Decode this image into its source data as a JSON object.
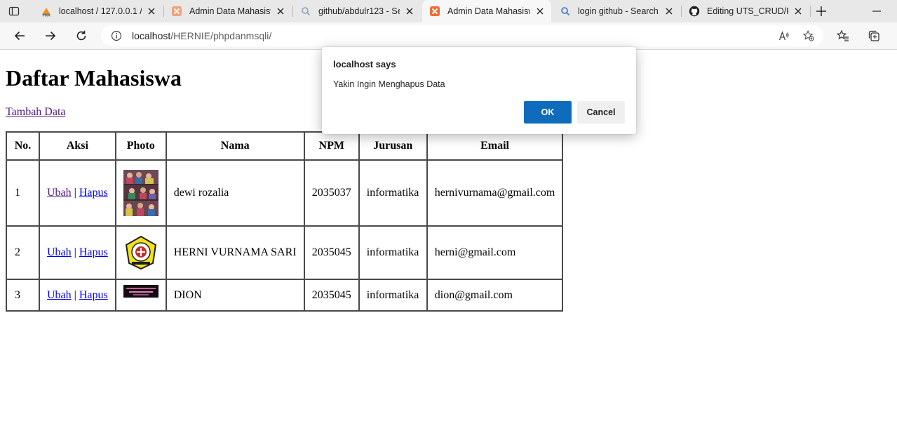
{
  "browser": {
    "tabs": [
      {
        "title": "localhost / 127.0.0.1 / t",
        "icon": "phpmyadmin-icon",
        "active": false
      },
      {
        "title": "Admin Data Mahasisw",
        "icon": "xampp-icon",
        "active": false
      },
      {
        "title": "github/abdulr123 - Se",
        "icon": "search-icon",
        "active": false
      },
      {
        "title": "Admin Data Mahasisw",
        "icon": "xampp-icon",
        "active": true
      },
      {
        "title": "login github - Search",
        "icon": "search-icon",
        "active": false
      },
      {
        "title": "Editing UTS_CRUD/RE",
        "icon": "github-icon",
        "active": false
      }
    ],
    "address": {
      "host": "localhost",
      "path": "/HERNIE/phpdanmsqli/"
    }
  },
  "page": {
    "heading": "Daftar Mahasiswa",
    "add_link": "Tambah Data",
    "table": {
      "headers": [
        "No.",
        "Aksi",
        "Photo",
        "Nama",
        "NPM",
        "Jurusan",
        "Email"
      ],
      "edit_label": "Ubah",
      "delete_label": "Hapus",
      "separator": "|",
      "rows": [
        {
          "no": "1",
          "nama": "dewi rozalia",
          "npm": "2035037",
          "jurusan": "informatika",
          "email": "hernivurnama@gmail.com",
          "photo": "group-photo"
        },
        {
          "no": "2",
          "nama": "HERNI VURNAMA SARI",
          "npm": "2035045",
          "jurusan": "informatika",
          "email": "herni@gmail.com",
          "photo": "university-logo"
        },
        {
          "no": "3",
          "nama": "DION",
          "npm": "2035045",
          "jurusan": "informatika",
          "email": "dion@gmail.com",
          "photo": "banner-image"
        }
      ]
    }
  },
  "dialog": {
    "title": "localhost says",
    "message": "Yakin Ingin Menghapus Data",
    "ok_label": "OK",
    "cancel_label": "Cancel"
  },
  "colors": {
    "ok_button": "#0f6cbd",
    "visited_link": "#551a8b",
    "link": "#0000ee"
  }
}
